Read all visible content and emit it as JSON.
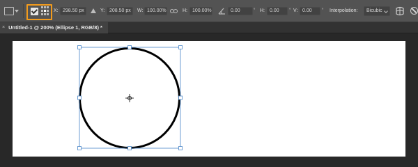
{
  "options_bar": {
    "tool_preset_icon": "transform-tool-preset-icon",
    "reference_point_checkbox": {
      "checked": true
    },
    "x": {
      "label": "X:",
      "value": "298.50 px"
    },
    "y": {
      "label": "Y:",
      "value": "208.50 px"
    },
    "width": {
      "label": "W:",
      "value": "100.00%"
    },
    "height": {
      "label": "H:",
      "value": "100.00%"
    },
    "rotate": {
      "value": "0.00"
    },
    "h_skew": {
      "label": "H:",
      "value": "0.00"
    },
    "v_skew": {
      "label": "V:",
      "value": "0.00"
    },
    "degree_symbol": "°",
    "interpolation": {
      "label": "Interpolation:",
      "value": "Bicubic"
    }
  },
  "document_tab": {
    "close_glyph": "×",
    "title": "Untitled-1 @ 200% (Ellipse 1, RGB/8) *"
  },
  "colors": {
    "highlight": "#f29b1d",
    "selection": "#4a86c8",
    "ellipse_stroke": "#000000",
    "canvas": "#ffffff"
  }
}
